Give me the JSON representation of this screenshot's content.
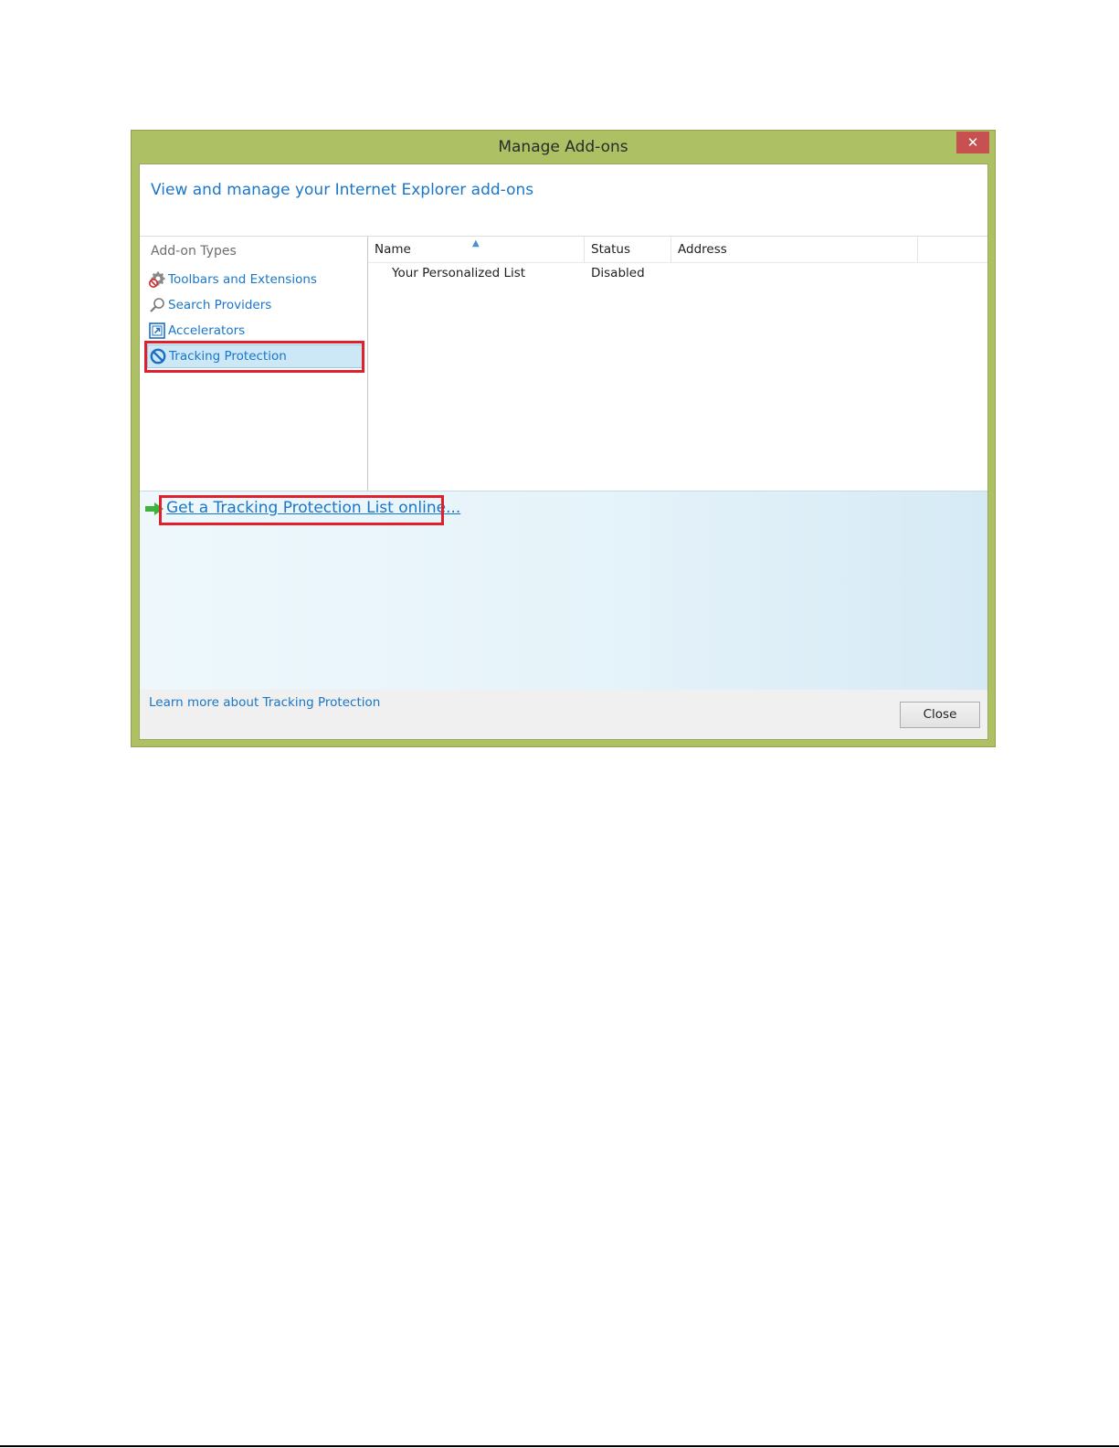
{
  "window": {
    "title": "Manage Add-ons",
    "close_glyph": "✕"
  },
  "header": {
    "text": "View and manage your Internet Explorer add-ons"
  },
  "sidebar": {
    "title": "Add-on Types",
    "items": [
      {
        "label": "Toolbars and Extensions",
        "icon": "gear-icon",
        "selected": false
      },
      {
        "label": "Search Providers",
        "icon": "magnifier-icon",
        "selected": false
      },
      {
        "label": "Accelerators",
        "icon": "accelerator-icon",
        "selected": false
      },
      {
        "label": "Tracking Protection",
        "icon": "block-icon",
        "selected": true
      }
    ]
  },
  "list": {
    "sort_indicator": "▲",
    "columns": [
      "Name",
      "Status",
      "Address"
    ],
    "rows": [
      {
        "name": "Your Personalized List",
        "status": "Disabled",
        "address": ""
      }
    ]
  },
  "details": {
    "link_text": "Get a Tracking Protection List online..."
  },
  "footer": {
    "learn_more": "Learn more about Tracking Protection",
    "close_label": "Close"
  },
  "colors": {
    "frame": "#adc064",
    "link": "#1a76c8",
    "highlight": "#e0202a",
    "selection": "#cce8f6"
  }
}
